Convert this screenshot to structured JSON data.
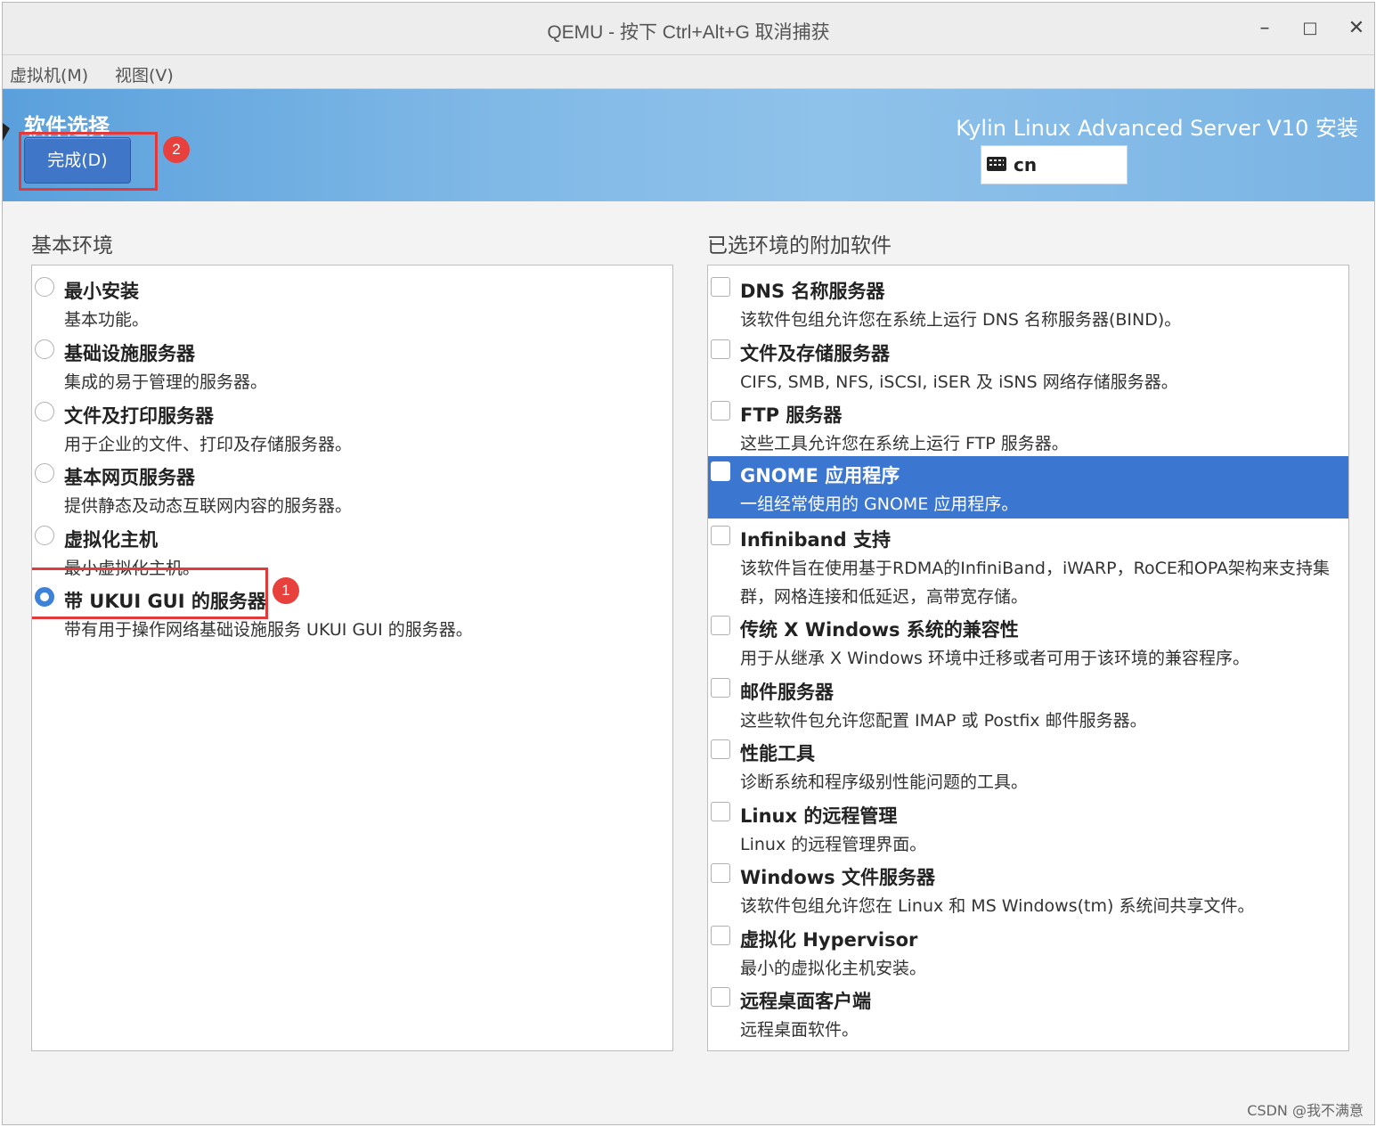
{
  "window": {
    "title": "QEMU - 按下 Ctrl+Alt+G 取消捕获",
    "minimize": "–",
    "maximize": "□",
    "close": "✕"
  },
  "menubar": {
    "items": [
      {
        "label": "虚拟机(M)"
      },
      {
        "label": "视图(V)"
      }
    ]
  },
  "header": {
    "title": "软件选择",
    "done_label": "完成(D)",
    "product": "Kylin Linux Advanced Server V10 安装",
    "keyboard_layout": "cn"
  },
  "annotations": [
    {
      "number": "1"
    },
    {
      "number": "2"
    }
  ],
  "base_environment": {
    "label": "基本环境",
    "selected_index": 5,
    "items": [
      {
        "title": "最小安装",
        "desc": "基本功能。"
      },
      {
        "title": "基础设施服务器",
        "desc": "集成的易于管理的服务器。"
      },
      {
        "title": "文件及打印服务器",
        "desc": "用于企业的文件、打印及存储服务器。"
      },
      {
        "title": "基本网页服务器",
        "desc": "提供静态及动态互联网内容的服务器。"
      },
      {
        "title": "虚拟化主机",
        "desc": "最小虚拟化主机。"
      },
      {
        "title": "带 UKUI GUI 的服务器",
        "desc": "带有用于操作网络基础设施服务 UKUI GUI 的服务器。"
      }
    ]
  },
  "addons": {
    "label": "已选环境的附加软件",
    "highlighted_index": 3,
    "items": [
      {
        "title": "DNS 名称服务器",
        "desc": "该软件包组允许您在系统上运行 DNS 名称服务器(BIND)。",
        "checked": false
      },
      {
        "title": "文件及存储服务器",
        "desc": "CIFS, SMB, NFS, iSCSI, iSER 及 iSNS 网络存储服务器。",
        "checked": false
      },
      {
        "title": "FTP 服务器",
        "desc": "这些工具允许您在系统上运行 FTP 服务器。",
        "checked": false
      },
      {
        "title": "GNOME 应用程序",
        "desc": "一组经常使用的 GNOME 应用程序。",
        "checked": false
      },
      {
        "title": "Infiniband 支持",
        "desc": "该软件旨在使用基于RDMA的InfiniBand，iWARP，RoCE和OPA架构来支持集",
        "desc2": "群，网格连接和低延迟，高带宽存储。",
        "checked": false
      },
      {
        "title": "传统 X Windows 系统的兼容性",
        "desc": "用于从继承 X Windows 环境中迁移或者可用于该环境的兼容程序。",
        "checked": false
      },
      {
        "title": "邮件服务器",
        "desc": "这些软件包允许您配置 IMAP 或 Postfix 邮件服务器。",
        "checked": false
      },
      {
        "title": "性能工具",
        "desc": "诊断系统和程序级别性能问题的工具。",
        "checked": false
      },
      {
        "title": "Linux 的远程管理",
        "desc": "Linux 的远程管理界面。",
        "checked": false
      },
      {
        "title": "Windows 文件服务器",
        "desc": "该软件包组允许您在 Linux 和 MS Windows(tm) 系统间共享文件。",
        "checked": false
      },
      {
        "title": "虚拟化 Hypervisor",
        "desc": "最小的虚拟化主机安装。",
        "checked": false
      },
      {
        "title": "远程桌面客户端",
        "desc": "远程桌面软件。",
        "checked": false
      }
    ]
  },
  "watermark": "CSDN @我不满意"
}
